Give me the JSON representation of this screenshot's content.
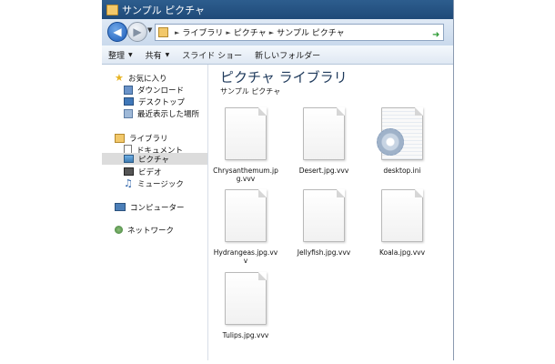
{
  "window": {
    "title": "サンプル ピクチャ"
  },
  "address": {
    "crumbs": [
      "ライブラリ",
      "ピクチャ",
      "サンプル ピクチャ"
    ]
  },
  "toolbar": {
    "organize": "整理",
    "share": "共有",
    "slideshow": "スライド ショー",
    "new_folder": "新しいフォルダー"
  },
  "nav": {
    "favorites": "お気に入り",
    "downloads": "ダウンロード",
    "desktop": "デスクトップ",
    "recent": "最近表示した場所",
    "libraries": "ライブラリ",
    "documents": "ドキュメント",
    "pictures": "ピクチャ",
    "videos": "ビデオ",
    "music": "ミュージック",
    "computer": "コンピューター",
    "network": "ネットワーク"
  },
  "content": {
    "title": "ピクチャ ライブラリ",
    "subtitle": "サンプル ピクチャ",
    "files": [
      "Chrysanthemum.jpg.vvv",
      "Desert.jpg.vvv",
      "desktop.ini",
      "Hydrangeas.jpg.vvv",
      "Jellyfish.jpg.vvv",
      "Koala.jpg.vvv",
      "Tulips.jpg.vvv"
    ]
  },
  "colors": {
    "title_bar": "#1f4a78",
    "selection": "#dcdcdc",
    "library_title": "#1e395b"
  }
}
